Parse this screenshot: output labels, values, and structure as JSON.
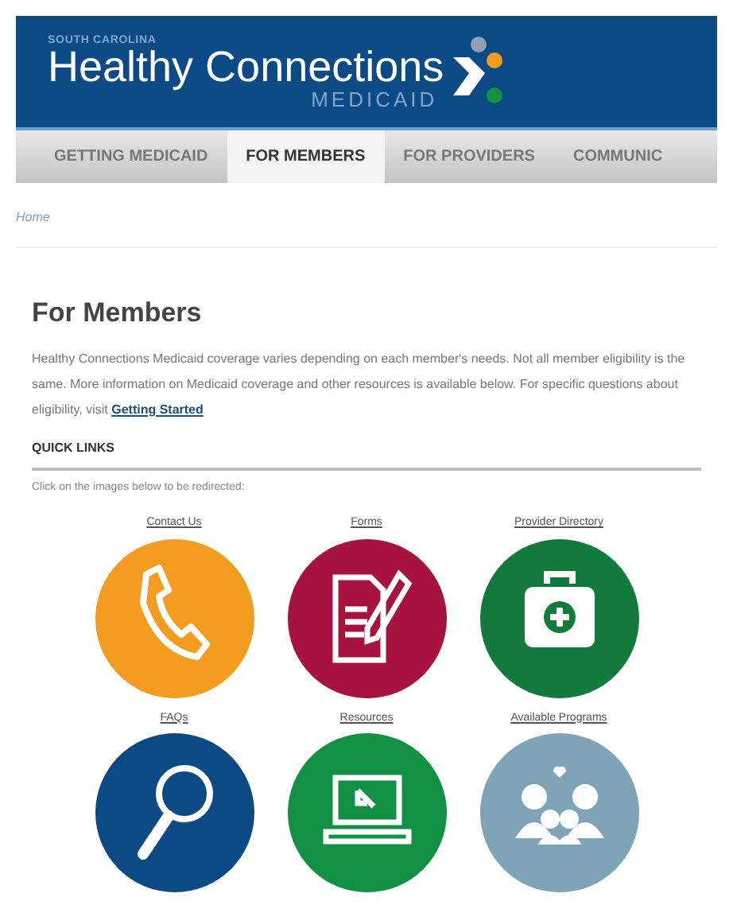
{
  "header": {
    "state": "SOUTH CAROLINA",
    "title": "Healthy Connections",
    "subtitle": "MEDICAID"
  },
  "nav": [
    {
      "label": "GETTING MEDICAID",
      "selected": false
    },
    {
      "label": "FOR MEMBERS",
      "selected": true
    },
    {
      "label": "FOR PROVIDERS",
      "selected": false
    },
    {
      "label": "COMMUNIC",
      "selected": false
    }
  ],
  "breadcrumb": "Home",
  "heading": "For Members",
  "intro": {
    "text": "Healthy Connections Medicaid coverage varies depending on each member's needs. Not all member eligibility is the same. More information on Medicaid coverage and other resources is available below. For specific questions about eligibility, visit",
    "link": "Getting Started"
  },
  "quick_links": {
    "title": "QUICK LINKS",
    "hint": "Click on the images below to be redirected:",
    "items": [
      {
        "label": "Contact Us",
        "color": "#f39c1f"
      },
      {
        "label": "Forms",
        "color": "#a8123f"
      },
      {
        "label": "Provider Directory",
        "color": "#127a3a"
      },
      {
        "label": "FAQs",
        "color": "#0b4a84"
      },
      {
        "label": "Resources",
        "color": "#129144"
      },
      {
        "label": "Available Programs",
        "color": "#7fa4b8"
      }
    ]
  }
}
